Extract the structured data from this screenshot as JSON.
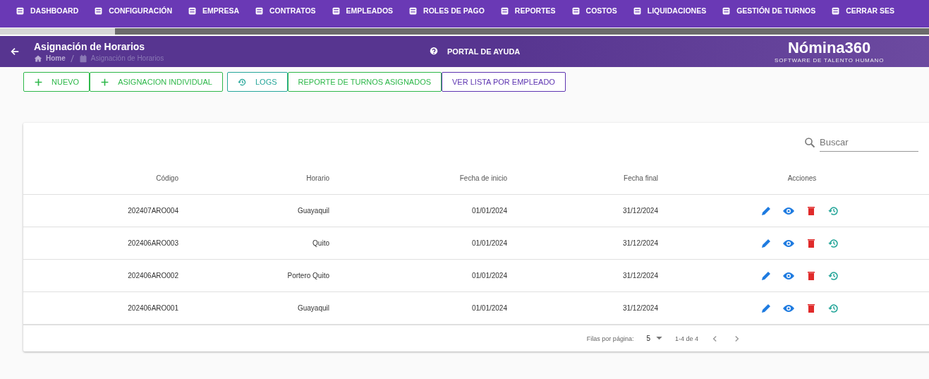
{
  "nav": [
    {
      "label": "DASHBOARD"
    },
    {
      "label": "CONFIGURACIÓN"
    },
    {
      "label": "EMPRESA"
    },
    {
      "label": "CONTRATOS"
    },
    {
      "label": "EMPLEADOS"
    },
    {
      "label": "ROLES DE PAGO"
    },
    {
      "label": "REPORTES"
    },
    {
      "label": "COSTOS"
    },
    {
      "label": "LIQUIDACIONES"
    },
    {
      "label": "GESTIÓN DE TURNOS"
    },
    {
      "label": "CERRAR SES"
    }
  ],
  "header": {
    "title": "Asignación de Horarios",
    "breadcrumb": [
      "Home",
      "Asignación de Horarios"
    ],
    "help": "PORTAL DE AYUDA",
    "logo": "Nómina360",
    "tagline": "SOFTWARE DE TALENTO HUMANO"
  },
  "buttons": [
    {
      "label": "NUEVO",
      "kind": "plus",
      "color": "#2eb84a"
    },
    {
      "label": "ASIGNACION INDIVIDUAL",
      "kind": "plus",
      "color": "#2eb84a"
    },
    {
      "label": "LOGS",
      "kind": "history",
      "color": "#26a69a"
    },
    {
      "label": "REPORTE DE TURNOS ASIGNADOS",
      "kind": "plain",
      "color": "#2eb84a"
    },
    {
      "label": "VER LISTA POR EMPLEADO",
      "kind": "plain",
      "color": "#5e35b1"
    }
  ],
  "search": {
    "placeholder": "Buscar"
  },
  "table": {
    "columns": [
      "Código",
      "Horario",
      "Fecha de inicio",
      "Fecha final",
      "Acciones"
    ],
    "rows": [
      [
        "202407ARO004",
        "Guayaquil",
        "01/01/2024",
        "31/12/2024"
      ],
      [
        "202406ARO003",
        "Quito",
        "01/01/2024",
        "31/12/2024"
      ],
      [
        "202406ARO002",
        "Portero Quito",
        "01/01/2024",
        "31/12/2024"
      ],
      [
        "202406ARO001",
        "Guayaquil",
        "01/01/2024",
        "31/12/2024"
      ]
    ]
  },
  "footer": {
    "rows_label": "Filas por página:",
    "rows_per_page": "5",
    "range": "1-4 de 4"
  }
}
